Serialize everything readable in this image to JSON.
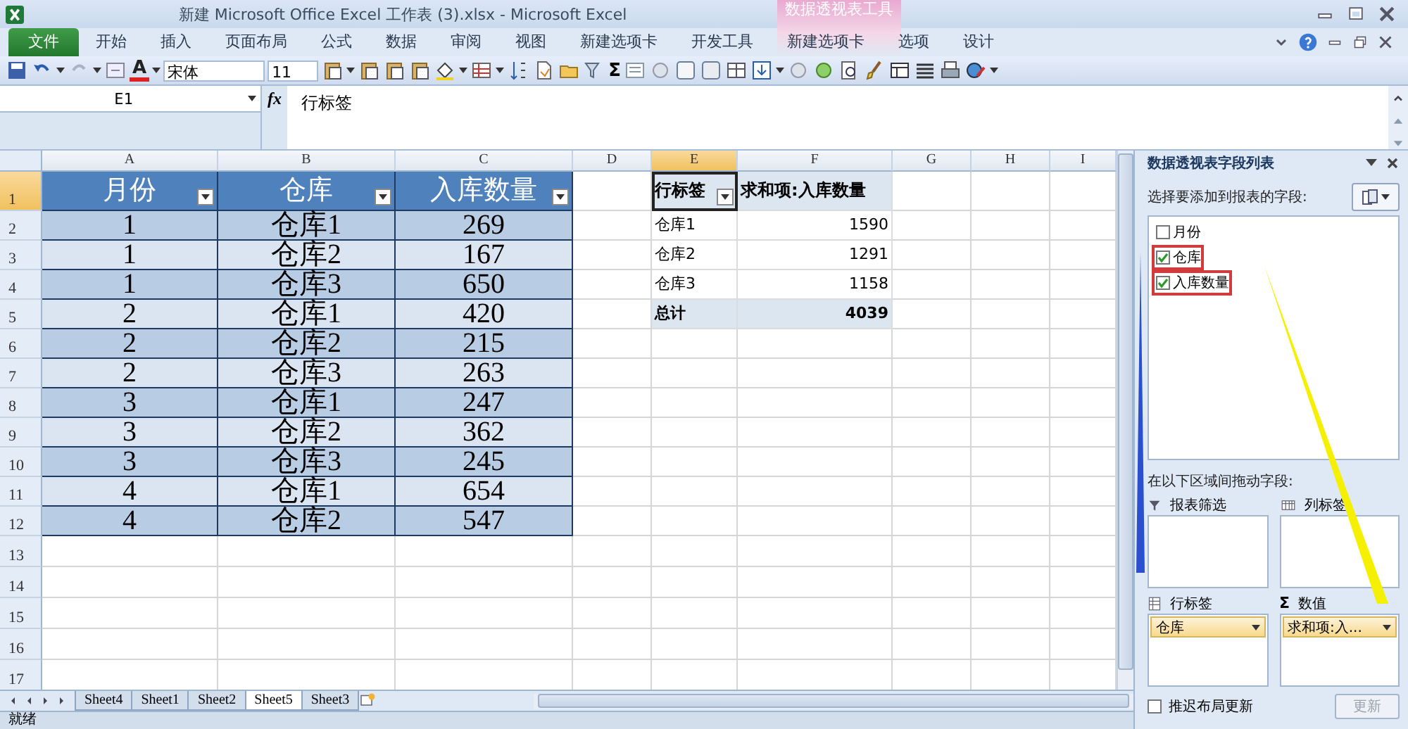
{
  "window": {
    "title": "新建 Microsoft Office Excel 工作表 (3).xlsx  -  Microsoft Excel",
    "context_group": "数据透视表工具"
  },
  "ribbon_tabs": [
    {
      "label": "文件",
      "kind": "file"
    },
    {
      "label": "开始",
      "kind": "normal"
    },
    {
      "label": "插入",
      "kind": "normal"
    },
    {
      "label": "页面布局",
      "kind": "normal"
    },
    {
      "label": "公式",
      "kind": "normal"
    },
    {
      "label": "数据",
      "kind": "normal"
    },
    {
      "label": "审阅",
      "kind": "normal"
    },
    {
      "label": "视图",
      "kind": "normal"
    },
    {
      "label": "新建选项卡",
      "kind": "normal"
    },
    {
      "label": "开发工具",
      "kind": "normal"
    },
    {
      "label": "新建选项卡",
      "kind": "normal"
    },
    {
      "label": "选项",
      "kind": "context"
    },
    {
      "label": "设计",
      "kind": "context"
    }
  ],
  "toolbar": {
    "font_color_glyph": "A",
    "font": "宋体",
    "size": "11",
    "sum_glyph": "Σ"
  },
  "formula_bar": {
    "cell_name": "E1",
    "function_glyph": "fx",
    "content": "行标签"
  },
  "grid": {
    "columns": [
      {
        "label": "A",
        "selected": false
      },
      {
        "label": "B",
        "selected": false
      },
      {
        "label": "C",
        "selected": false
      },
      {
        "label": "D",
        "selected": false
      },
      {
        "label": "E",
        "selected": true
      },
      {
        "label": "F",
        "selected": false
      },
      {
        "label": "G",
        "selected": false
      },
      {
        "label": "H",
        "selected": false
      },
      {
        "label": "I",
        "selected": false
      }
    ],
    "rows": [
      {
        "label": "1",
        "selected": true
      },
      {
        "label": "2",
        "selected": false
      },
      {
        "label": "3",
        "selected": false
      },
      {
        "label": "4",
        "selected": false
      },
      {
        "label": "5",
        "selected": false
      },
      {
        "label": "6",
        "selected": false
      },
      {
        "label": "7",
        "selected": false
      },
      {
        "label": "8",
        "selected": false
      },
      {
        "label": "9",
        "selected": false
      },
      {
        "label": "10",
        "selected": false
      },
      {
        "label": "11",
        "selected": false
      },
      {
        "label": "12",
        "selected": false
      },
      {
        "label": "13",
        "selected": false
      },
      {
        "label": "14",
        "selected": false
      },
      {
        "label": "15",
        "selected": false
      },
      {
        "label": "16",
        "selected": false
      },
      {
        "label": "17",
        "selected": false
      }
    ]
  },
  "source_table": {
    "headers": [
      "月份",
      "仓库",
      "入库数量"
    ],
    "rows": [
      [
        "1",
        "仓库1",
        "269"
      ],
      [
        "1",
        "仓库2",
        "167"
      ],
      [
        "1",
        "仓库3",
        "650"
      ],
      [
        "2",
        "仓库1",
        "420"
      ],
      [
        "2",
        "仓库2",
        "215"
      ],
      [
        "2",
        "仓库3",
        "263"
      ],
      [
        "3",
        "仓库1",
        "247"
      ],
      [
        "3",
        "仓库2",
        "362"
      ],
      [
        "3",
        "仓库3",
        "245"
      ],
      [
        "4",
        "仓库1",
        "654"
      ],
      [
        "4",
        "仓库2",
        "547"
      ]
    ]
  },
  "pivot_table": {
    "headers": [
      {
        "label": "行标签",
        "selected": true
      },
      {
        "label": "求和项:入库数量",
        "selected": false
      }
    ],
    "rows": [
      {
        "label": "仓库1",
        "value": "1590"
      },
      {
        "label": "仓库2",
        "value": "1291"
      },
      {
        "label": "仓库3",
        "value": "1158"
      }
    ],
    "total": {
      "label": "总计",
      "value": "4039"
    }
  },
  "sheet_tabs": [
    {
      "label": "Sheet4",
      "selected": false
    },
    {
      "label": "Sheet1",
      "selected": false
    },
    {
      "label": "Sheet2",
      "selected": false
    },
    {
      "label": "Sheet5",
      "selected": true
    },
    {
      "label": "Sheet3",
      "selected": false
    }
  ],
  "status_bar": {
    "text": "就绪"
  },
  "field_list": {
    "title": "数据透视表字段列表",
    "prompt": "选择要添加到报表的字段:",
    "fields": [
      {
        "label": "月份",
        "checked": false,
        "highlighted": false
      },
      {
        "label": "仓库",
        "checked": true,
        "highlighted": true
      },
      {
        "label": "入库数量",
        "checked": true,
        "highlighted": true
      }
    ],
    "drag_prompt": "在以下区域间拖动字段:",
    "areas": [
      {
        "title": "报表筛选",
        "kind": "filter"
      },
      {
        "title": "列标签",
        "kind": "columns"
      },
      {
        "title": "行标签",
        "kind": "rows",
        "items": [
          "仓库"
        ]
      },
      {
        "title": "数值",
        "kind": "values",
        "glyph": "Σ",
        "items": [
          "求和项:入..."
        ]
      }
    ],
    "defer": {
      "label": "推迟布局更新",
      "checked": false
    },
    "update_button": {
      "label": "更新",
      "disabled": true
    },
    "annotations": [
      {
        "kind": "arrow",
        "color": "#2a50d0"
      },
      {
        "kind": "arrow",
        "color": "#f4f000"
      }
    ]
  }
}
